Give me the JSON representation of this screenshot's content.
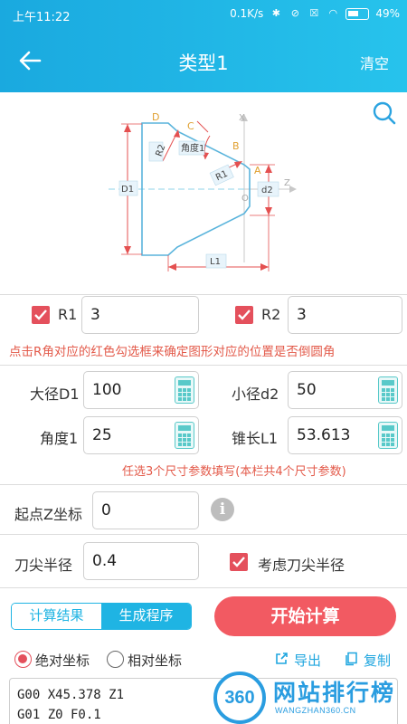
{
  "status_bar": {
    "time": "上午11:22",
    "net_speed": "0.1K/s",
    "battery": "49"
  },
  "app_bar": {
    "title": "类型1",
    "clear_label": "清空"
  },
  "diagram": {
    "labels": {
      "D": "D",
      "C": "C",
      "B": "B",
      "A": "A",
      "X": "X",
      "Z": "Z",
      "O": "O",
      "R1": "R1",
      "R2": "R2",
      "angle": "角度1",
      "D1": "D1",
      "d2": "d2",
      "L1": "L1"
    }
  },
  "radius_row": {
    "r1_label": "R1",
    "r1_value": "3",
    "r1_checked": true,
    "r2_label": "R2",
    "r2_value": "3",
    "r2_checked": true,
    "note": "点击R角对应的红色勾选框来确定图形对应的位置是否倒圆角"
  },
  "dims": {
    "big_diameter_label": "大径D1",
    "big_diameter_value": "100",
    "small_diameter_label": "小径d2",
    "small_diameter_value": "50",
    "angle_label": "角度1",
    "angle_value": "25",
    "cone_length_label": "锥长L1",
    "cone_length_value": "53.613",
    "note": "任选3个尺寸参数填写(本栏共4个尺寸参数)"
  },
  "start_z": {
    "label": "起点Z坐标",
    "value": "0"
  },
  "tool_radius": {
    "label": "刀尖半径",
    "value": "0.4",
    "consider_label": "考虑刀尖半径",
    "consider_checked": true
  },
  "tabs": {
    "result": "计算结果",
    "program": "生成程序",
    "active": "program"
  },
  "start_button": "开始计算",
  "coords": {
    "absolute": "绝对坐标",
    "relative": "相对坐标",
    "selected": "absolute"
  },
  "actions": {
    "export": "导出",
    "copy": "复制"
  },
  "program_output": [
    "G00 X45.378 Z1",
    "G01 Z0 F0.1"
  ],
  "watermark": {
    "badge": "360",
    "title": "网站排行榜",
    "subtitle": "WANGZHAN360.CN"
  },
  "colors": {
    "header": "#1fb4e3",
    "accent_red": "#f25a62",
    "checkbox": "#e4505c",
    "calc_icon": "#58c9c9"
  }
}
